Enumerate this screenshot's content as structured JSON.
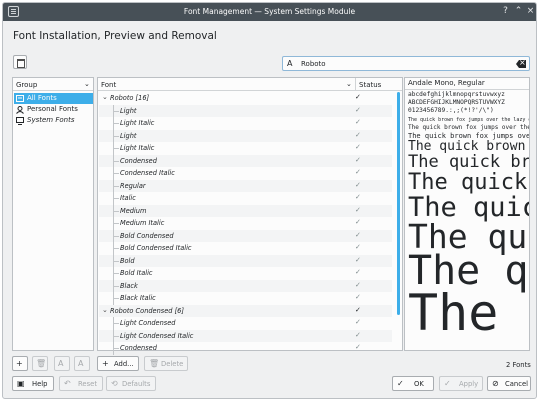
{
  "window": {
    "title": "Font Management — System Settings Module"
  },
  "page": {
    "title": "Font Installation, Preview and Removal"
  },
  "search": {
    "value": "Roboto"
  },
  "groups": {
    "header": "Group",
    "items": [
      {
        "label": "All Fonts",
        "icon": "all-fonts-icon"
      },
      {
        "label": "Personal Fonts",
        "icon": "person-icon"
      },
      {
        "label": "System Fonts",
        "icon": "monitor-icon"
      }
    ]
  },
  "fonts": {
    "header_font": "Font",
    "header_status": "Status",
    "rows": [
      {
        "name": "Roboto [16]",
        "parent": true
      },
      {
        "name": "Light"
      },
      {
        "name": "Light Italic"
      },
      {
        "name": "Light"
      },
      {
        "name": "Light Italic"
      },
      {
        "name": "Condensed"
      },
      {
        "name": "Condensed Italic"
      },
      {
        "name": "Regular"
      },
      {
        "name": "Italic"
      },
      {
        "name": "Medium"
      },
      {
        "name": "Medium Italic"
      },
      {
        "name": "Bold Condensed"
      },
      {
        "name": "Bold Condensed Italic"
      },
      {
        "name": "Bold"
      },
      {
        "name": "Bold Italic"
      },
      {
        "name": "Black"
      },
      {
        "name": "Black Italic"
      },
      {
        "name": "Roboto Condensed [6]",
        "parent": true
      },
      {
        "name": "Light Condensed"
      },
      {
        "name": "Light Condensed Italic"
      },
      {
        "name": "Condensed"
      }
    ],
    "check_glyph": "✓",
    "expander_glyph": "⌄"
  },
  "preview": {
    "font_name": "Andale Mono, Regular",
    "lines": [
      "abcdefghijklmnopqrstuvwxyz",
      "ABCDEFGHIJKLMNOPQRSTUVWXYZ",
      "0123456789.:,;(*!?'/\\\")",
      "The quick brown fox jumps over the lazy dog.",
      "The quick brown fox jumps over the lazy dog.",
      "The quick brown fox jumps over the lazy dog.",
      "The quick brown fox",
      "The quick brown",
      "The quick",
      "The quick",
      "The quick",
      "The quick",
      "The"
    ]
  },
  "bottom_toolbar": {
    "add_label": "Add...",
    "delete_label": "Delete",
    "count_label": "2 Fonts"
  },
  "footer": {
    "help_label": "Help",
    "reset_label": "Reset",
    "defaults_label": "Defaults",
    "ok_label": "OK",
    "apply_label": "Apply",
    "cancel_label": "Cancel"
  }
}
